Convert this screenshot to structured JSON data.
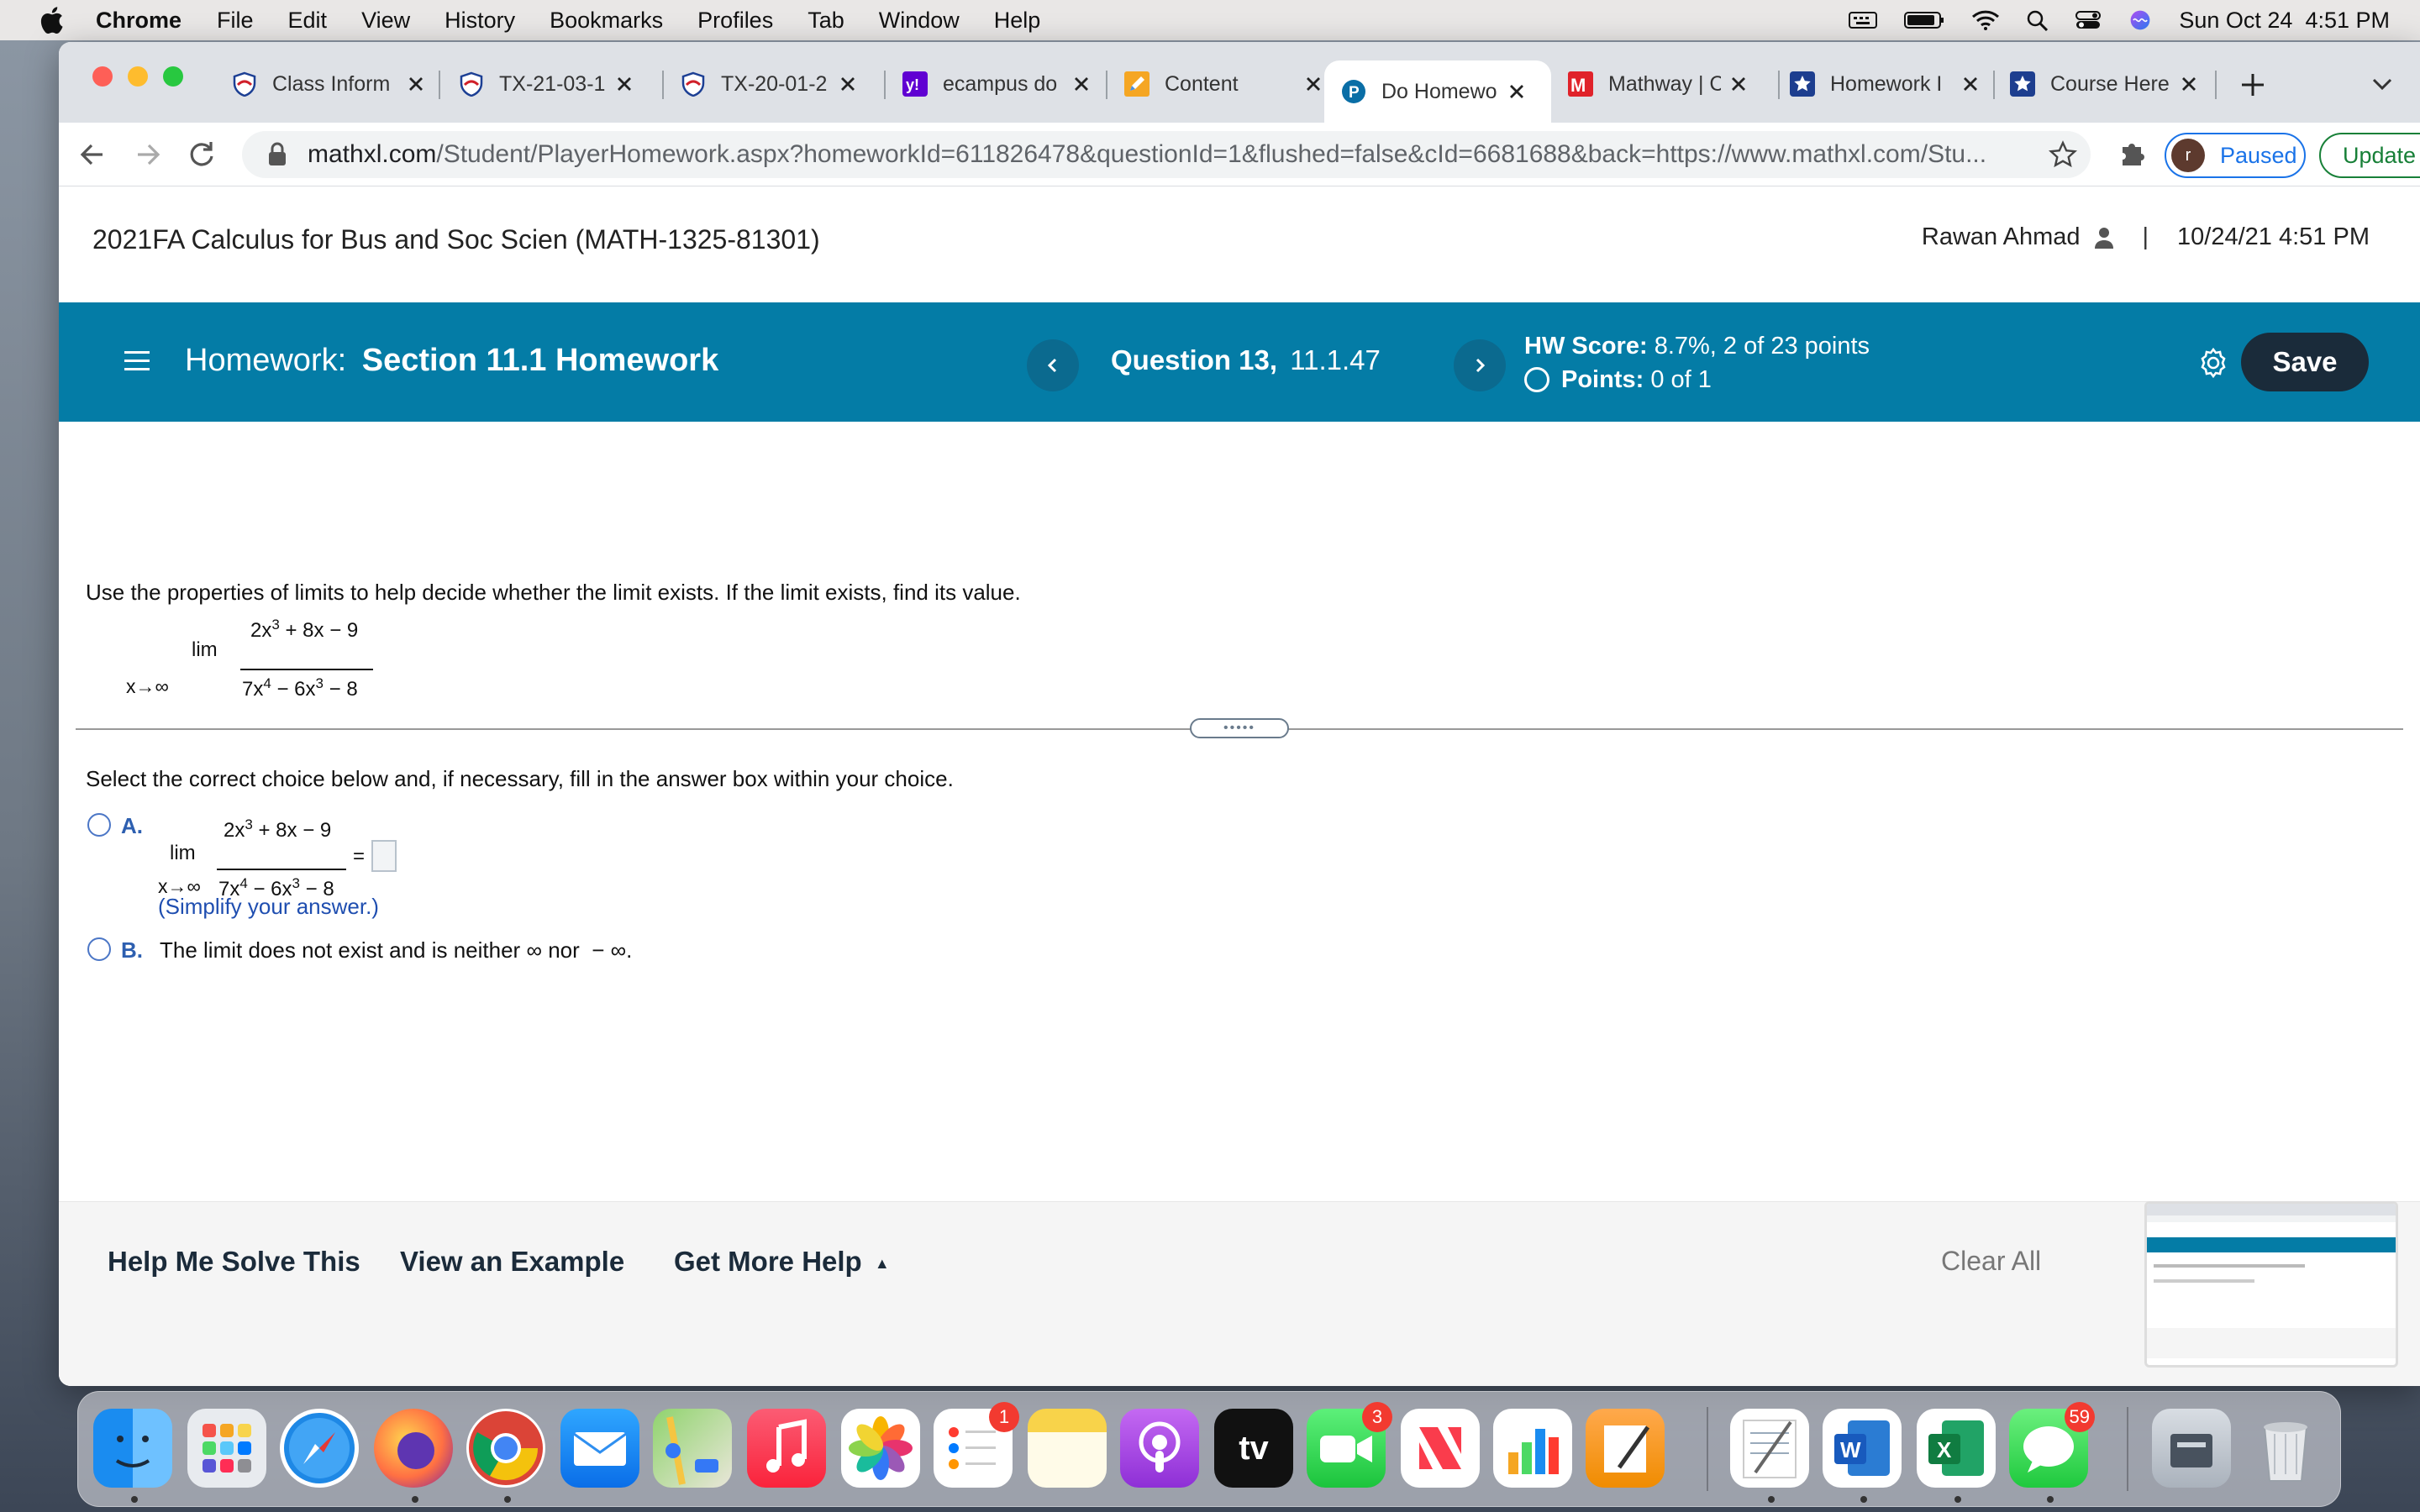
{
  "menubar": {
    "app_name": "Chrome",
    "items": [
      "File",
      "Edit",
      "View",
      "History",
      "Bookmarks",
      "Profiles",
      "Tab",
      "Window",
      "Help"
    ],
    "datetime": "Sun Oct 24  4:51 PM"
  },
  "tabs": [
    {
      "title": "Class Inform",
      "icon": "shield-icon"
    },
    {
      "title": "TX-21-03-1",
      "icon": "shield-icon"
    },
    {
      "title": "TX-20-01-2",
      "icon": "shield-icon"
    },
    {
      "title": "ecampus do",
      "icon": "yahoo-icon"
    },
    {
      "title": "Content",
      "icon": "pencil-icon"
    },
    {
      "title": "Do Homewo",
      "icon": "pearson-icon",
      "active": true
    },
    {
      "title": "Mathway | C",
      "icon": "mathway-icon"
    },
    {
      "title": "Homework I",
      "icon": "star-icon"
    },
    {
      "title": "Course Here",
      "icon": "star-icon"
    }
  ],
  "toolbar": {
    "url_host": "mathxl.com",
    "url_path": "/Student/PlayerHomework.aspx?homeworkId=611826478&questionId=1&flushed=false&cId=6681688&back=https://www.mathxl.com/Stu...",
    "profile_initial": "r",
    "profile_label": "Paused",
    "update_label": "Update"
  },
  "course": {
    "title": "2021FA Calculus for Bus and Soc Scien (MATH-1325-81301)",
    "user_name": "Rawan Ahmad",
    "datetime": "10/24/21 4:51 PM"
  },
  "homework": {
    "prefix": "Homework:",
    "name": "Section 11.1 Homework",
    "question_label": "Question 13,",
    "question_id": "11.1.47",
    "score_label": "HW Score:",
    "score_value": "8.7%, 2 of 23 points",
    "points_label": "Points:",
    "points_value": "0 of 1",
    "save_label": "Save"
  },
  "question": {
    "instruction": "Use the properties of limits to help decide whether the limit exists. If the limit exists, find its value.",
    "lim": "lim",
    "lim_sub": "x→∞",
    "numerator_a": "2x",
    "numerator_exp": "3",
    "numerator_b": " + 8x − 9",
    "denominator_a": "7x",
    "denominator_exp1": "4",
    "denominator_b": " − 6x",
    "denominator_exp2": "3",
    "denominator_c": " − 8",
    "select_prompt": "Select the correct choice below and, if necessary, fill in the answer box within your choice.",
    "choice_a_letter": "A.",
    "equals": "=",
    "simplify_hint": "(Simplify your answer.)",
    "choice_b_letter": "B.",
    "choice_b_text": "The limit does not exist and is neither ∞ nor  − ∞."
  },
  "footer": {
    "help_solve": "Help Me Solve This",
    "view_example": "View an Example",
    "more_help": "Get More Help",
    "more_help_caret": "▲",
    "clear_all": "Clear All"
  },
  "dock": {
    "reminders_badge": "1",
    "facetime_badge": "3",
    "messages_badge": "59",
    "tv_label": "tv"
  }
}
